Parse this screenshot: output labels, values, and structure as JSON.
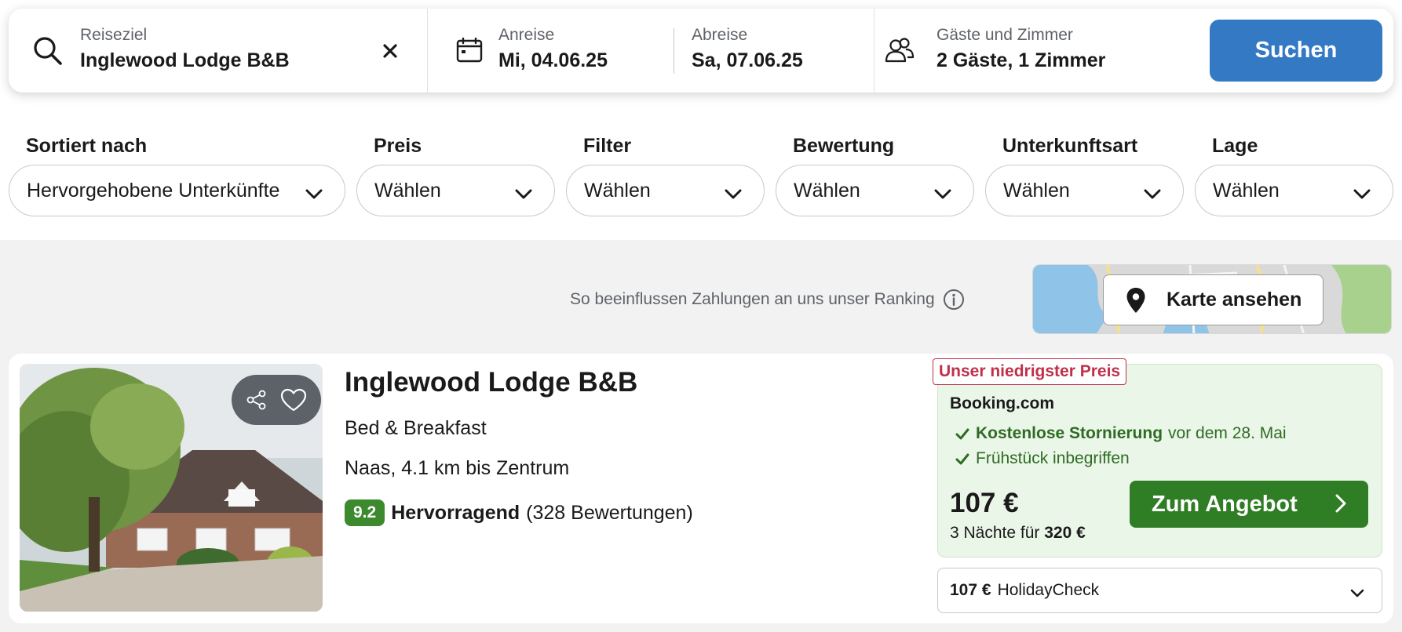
{
  "search": {
    "destination_label": "Reiseziel",
    "destination_value": "Inglewood Lodge B&B",
    "checkin_label": "Anreise",
    "checkin_value": "Mi, 04.06.25",
    "checkout_label": "Abreise",
    "checkout_value": "Sa, 07.06.25",
    "guests_label": "Gäste und Zimmer",
    "guests_value": "2 Gäste, 1 Zimmer",
    "search_button": "Suchen"
  },
  "filters": [
    {
      "label": "Sortiert nach",
      "value": "Hervorgehobene Unterkünfte"
    },
    {
      "label": "Preis",
      "value": "Wählen"
    },
    {
      "label": "Filter",
      "value": "Wählen"
    },
    {
      "label": "Bewertung",
      "value": "Wählen"
    },
    {
      "label": "Unterkunftsart",
      "value": "Wählen"
    },
    {
      "label": "Lage",
      "value": "Wählen"
    }
  ],
  "ranking_note": "So beeinflussen Zahlungen an uns unser Ranking",
  "map_button": "Karte ansehen",
  "result": {
    "title": "Inglewood Lodge B&B",
    "type": "Bed & Breakfast",
    "location": "Naas, 4.1 km bis Zentrum",
    "score": "9.2",
    "rating_word": "Hervorragend",
    "rating_count": "(328 Bewertungen)",
    "lowest_badge": "Unser niedrigster Preis",
    "provider": "Booking.com",
    "perk1_bold": "Kostenlose Stornierung",
    "perk1_rest": "vor dem 28. Mai",
    "perk2": "Frühstück inbegriffen",
    "price": "107 €",
    "nights_text": "3 Nächte für",
    "total_price": "320 €",
    "cta": "Zum Angebot",
    "alt_price": "107 €",
    "alt_provider": "HolidayCheck"
  },
  "colors": {
    "accent_blue": "#3379c4",
    "cta_green": "#2f7d24",
    "score_green": "#3d8a2e",
    "badge_red": "#c0304a",
    "offer_bg": "#eaf6e7"
  },
  "icons": {
    "destination": "search-icon",
    "clear": "close-icon",
    "dates": "calendar-icon",
    "guests": "people-icon",
    "info": "info-icon",
    "map": "map-pin-icon",
    "share": "share-icon",
    "favorite": "heart-icon",
    "dropdown": "chevron-down-icon",
    "cta": "chevron-right-icon",
    "perk": "check-icon"
  }
}
